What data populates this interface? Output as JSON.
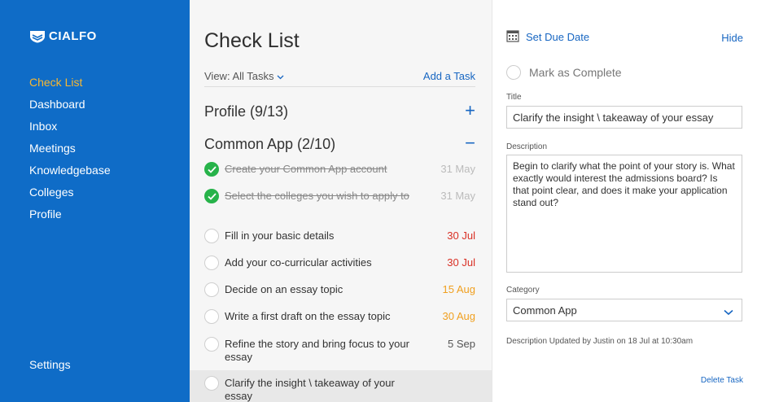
{
  "brand": {
    "name": "CIALFO",
    "icon": "cialfo-shield-logo"
  },
  "sidebar": {
    "items": [
      {
        "label": "Check List",
        "active": true
      },
      {
        "label": "Dashboard"
      },
      {
        "label": "Inbox"
      },
      {
        "label": "Meetings"
      },
      {
        "label": "Knowledgebase"
      },
      {
        "label": "Colleges"
      },
      {
        "label": "Profile"
      }
    ],
    "settings_label": "Settings"
  },
  "checklist": {
    "title": "Check List",
    "view_label": "View: All Tasks",
    "add_task_label": "Add a Task",
    "sections": [
      {
        "label": "Profile (9/13)",
        "toggle": "+"
      },
      {
        "label": "Common App (2/10)",
        "toggle": "−"
      }
    ],
    "tasks": [
      {
        "text": "Create your Common App account",
        "date": "31 May",
        "done": true
      },
      {
        "text": "Select the colleges you wish to apply to",
        "date": "31 May",
        "done": true
      },
      {
        "text": "Fill in your basic details",
        "date": "30 Jul",
        "done": false
      },
      {
        "text": "Add your co-curricular activities",
        "date": "30 Jul",
        "done": false
      },
      {
        "text": "Decide on an essay topic",
        "date": "15 Aug",
        "done": false
      },
      {
        "text": "Write a first draft on the essay topic",
        "date": "30 Aug",
        "done": false
      },
      {
        "text": "Refine the story and bring focus to your essay",
        "date": "5 Sep",
        "done": false
      },
      {
        "text": "Clarify the insight \\ takeaway of your essay",
        "date": "",
        "done": false
      }
    ]
  },
  "detail": {
    "set_due_date_label": "Set Due Date",
    "hide_label": "Hide",
    "mark_complete_label": "Mark as Complete",
    "title_label": "Title",
    "title_value": "Clarify the insight \\ takeaway of your essay",
    "description_label": "Description",
    "description_value": "Begin to clarify what the point of your story is. What exactly would interest the admissions board? Is that point clear, and does it make your application stand out?",
    "category_label": "Category",
    "category_value": "Common App",
    "updated_text": "Description Updated by Justin on 18 Jul at 10:30am",
    "delete_label": "Delete Task"
  },
  "colors": {
    "sidebar_bg": "#0f6cc7",
    "active_nav": "#f7b731",
    "accent_blue": "#1766c2",
    "done_green": "#27b34a",
    "overdue_red": "#d93025",
    "upcoming_orange": "#f0a020"
  }
}
